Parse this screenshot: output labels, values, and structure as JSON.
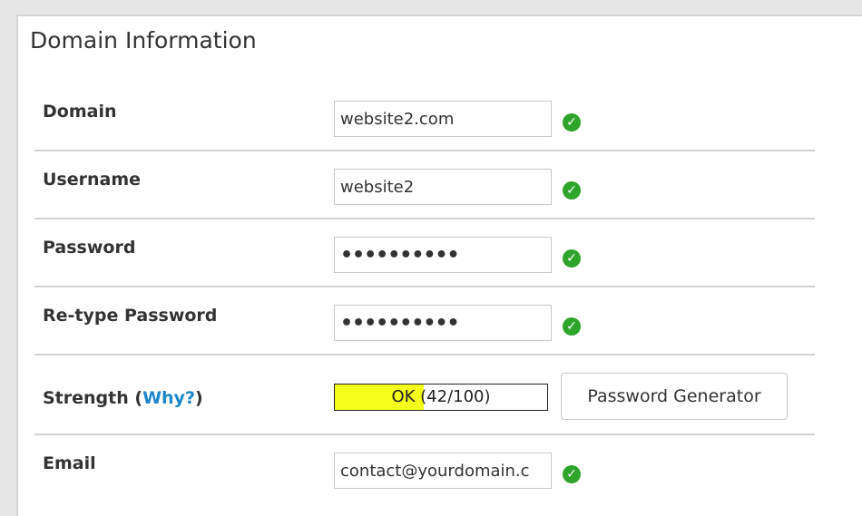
{
  "section": {
    "title": "Domain Information"
  },
  "fields": {
    "domain": {
      "label": "Domain",
      "value": "website2.com"
    },
    "username": {
      "label": "Username",
      "value": "website2"
    },
    "password": {
      "label": "Password",
      "value": "••••••••••"
    },
    "retype_password": {
      "label": "Re-type Password",
      "value": "••••••••••"
    },
    "email": {
      "label": "Email",
      "value": "contact@yourdomain.c"
    }
  },
  "strength": {
    "label": "Strength",
    "open_paren": "(",
    "why_link": "Why?",
    "close_paren": ")",
    "text": "OK (42/100)",
    "score": 42,
    "max": 100,
    "fill_color": "#f4ff1a"
  },
  "buttons": {
    "password_generator": "Password Generator"
  },
  "colors": {
    "valid_check": "#2ea52a",
    "link": "#1b87c8"
  },
  "icons": {
    "valid": "check-circle-icon"
  }
}
